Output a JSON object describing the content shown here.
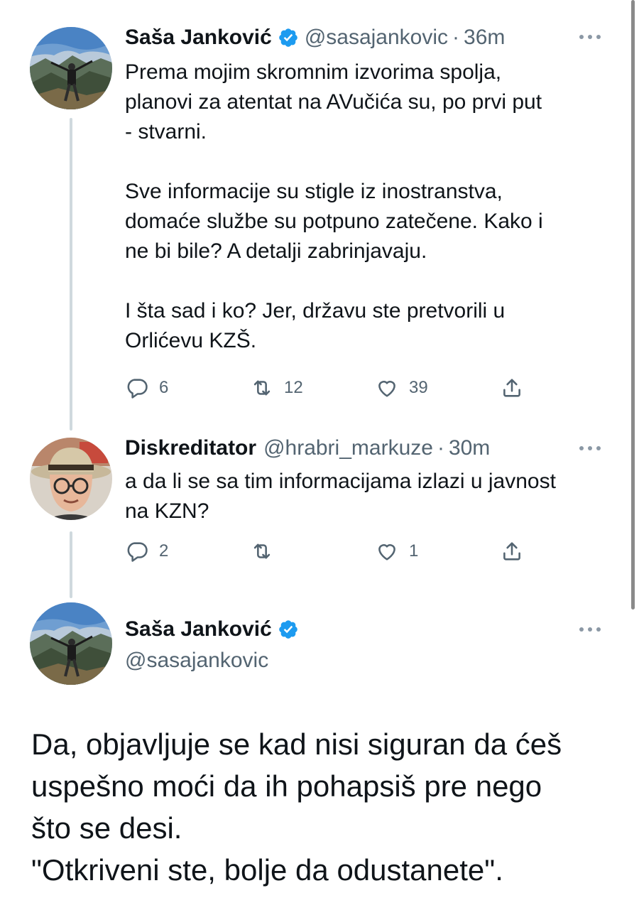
{
  "tweets": [
    {
      "display_name": "Saša Janković",
      "handle": "@sasajankovic",
      "separator": "·",
      "time": "36m",
      "text": "Prema mojim skromnim izvorima spolja,\nplanovi za atentat na AVučića su, po prvi put\n- stvarni.\n\nSve informacije su stigle iz inostranstva,\ndomaće službe su potpuno zatečene. Kako i\nne bi bile? A detalji zabrinjavaju.\n\nI šta sad i ko? Jer, državu ste pretvorili u\nOrlićevu KZŠ.",
      "replies": "6",
      "retweets": "12",
      "likes": "39"
    },
    {
      "display_name": "Diskreditator",
      "handle": "@hrabri_markuze",
      "separator": "·",
      "time": "30m",
      "text": "a da li se sa tim informacijama izlazi u javnost\nna KZN?",
      "replies": "2",
      "retweets": "",
      "likes": "1"
    }
  ],
  "main_tweet": {
    "display_name": "Saša Janković",
    "handle": "@sasajankovic",
    "text": "Da, objavljuje se kad nisi siguran da ćeš\nuspešno moći da ih pohapsiš pre nego\nšto se desi.\n\"Otkriveni ste, bolje da odustanete\"."
  },
  "icons": {
    "verified": "verified-badge-icon",
    "more": "more-options-icon",
    "reply": "reply-icon",
    "retweet": "retweet-icon",
    "like": "like-icon",
    "share": "share-icon"
  },
  "colors": {
    "verified": "#1d9bf0",
    "secondary_text": "#536471",
    "primary_text": "#0f1419",
    "thread_line": "#cfd9de"
  }
}
